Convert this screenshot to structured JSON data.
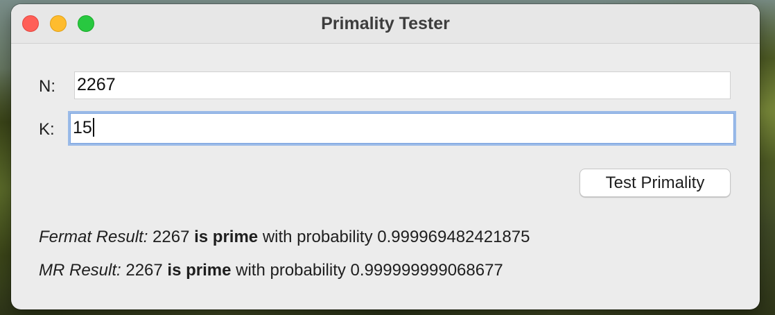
{
  "window": {
    "title": "Primality Tester"
  },
  "form": {
    "n_label": "N:",
    "n_value": "2267",
    "k_label": "K:",
    "k_value": "15",
    "test_button": "Test Primality"
  },
  "results": {
    "fermat": {
      "label": "Fermat Result:",
      "number": "2267",
      "verdict": "is prime",
      "tail": "with probability 0.999969482421875"
    },
    "mr": {
      "label": "MR Result:",
      "number": "2267",
      "verdict": "is prime",
      "tail": "with probability 0.999999999068677"
    }
  },
  "colors": {
    "close": "#ff5f57",
    "minimize": "#febc2e",
    "maximize": "#28c840",
    "focus_ring": "#9bbbe8"
  }
}
